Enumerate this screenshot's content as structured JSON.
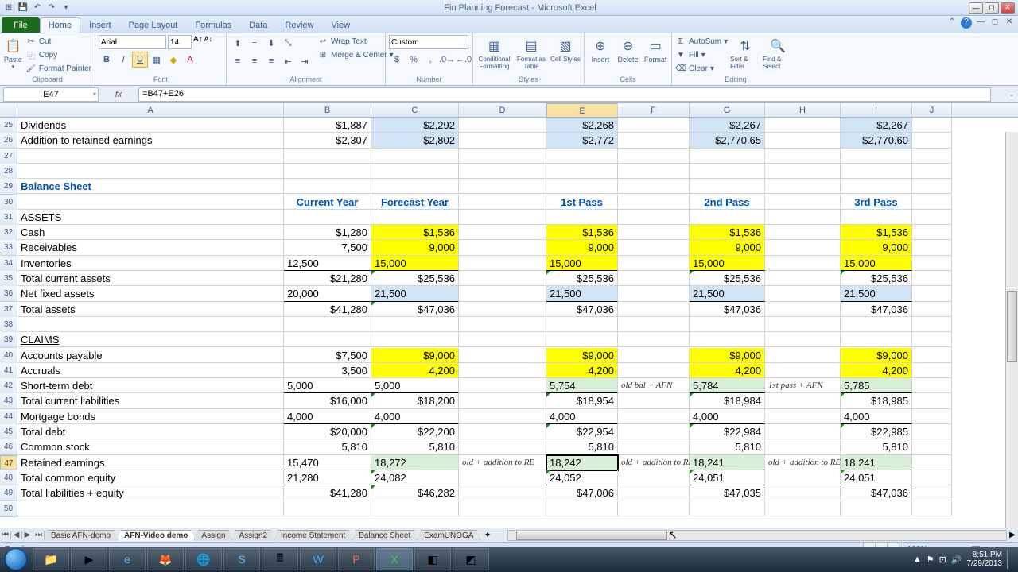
{
  "app": {
    "title": "Fin Planning Forecast - Microsoft Excel"
  },
  "qat": {
    "save": "💾",
    "undo": "↶",
    "redo": "↷"
  },
  "tabs": [
    "File",
    "Home",
    "Insert",
    "Page Layout",
    "Formulas",
    "Data",
    "Review",
    "View"
  ],
  "ribbon": {
    "clipboard": {
      "paste": "Paste",
      "cut": "Cut",
      "copy": "Copy",
      "painter": "Format Painter",
      "label": "Clipboard"
    },
    "font": {
      "name": "Arial",
      "size": "14",
      "label": "Font"
    },
    "alignment": {
      "wrap": "Wrap Text",
      "merge": "Merge & Center",
      "label": "Alignment"
    },
    "number": {
      "format": "Custom",
      "label": "Number"
    },
    "styles": {
      "cond": "Conditional Formatting",
      "table": "Format as Table",
      "cell": "Cell Styles",
      "label": "Styles"
    },
    "cells": {
      "insert": "Insert",
      "delete": "Delete",
      "format": "Format",
      "label": "Cells"
    },
    "editing": {
      "sum": "AutoSum",
      "fill": "Fill",
      "clear": "Clear",
      "sort": "Sort & Filter",
      "find": "Find & Select",
      "label": "Editing"
    }
  },
  "namebox": "E47",
  "formula": "=B47+E26",
  "columns": [
    "A",
    "B",
    "C",
    "D",
    "E",
    "F",
    "G",
    "H",
    "I",
    "J"
  ],
  "rowstart": 25,
  "rows": [
    {
      "n": 25,
      "A": "Dividends",
      "B": "$1,887",
      "C": "$2,292",
      "E": "$2,268",
      "G": "$2,267",
      "I": "$2,267",
      "bg": {
        "C": "lb",
        "E": "lb",
        "G": "lb",
        "I": "lb"
      }
    },
    {
      "n": 26,
      "A": "Addition to retained earnings",
      "B": "$2,307",
      "C": "$2,802",
      "E": "$2,772",
      "G": "$2,770.65",
      "I": "$2,770.60",
      "bg": {
        "C": "lb",
        "E": "lb",
        "G": "lb",
        "I": "lb"
      }
    },
    {
      "n": 27
    },
    {
      "n": 28
    },
    {
      "n": 29,
      "A": "Balance Sheet",
      "cls": {
        "A": "b blue"
      }
    },
    {
      "n": 30,
      "B": "Current Year",
      "C": "Forecast Year",
      "E": "1st Pass",
      "G": "2nd Pass",
      "I": "3rd Pass",
      "cls": {
        "B": "hdr",
        "C": "hdr",
        "E": "hdr",
        "G": "hdr",
        "I": "hdr"
      }
    },
    {
      "n": 31,
      "A": "ASSETS",
      "cls": {
        "A": "u"
      }
    },
    {
      "n": 32,
      "A": "Cash",
      "B": "$1,280",
      "C": "$1,536",
      "E": "$1,536",
      "G": "$1,536",
      "I": "$1,536",
      "bg": {
        "C": "yellow",
        "E": "yellow",
        "G": "yellow",
        "I": "yellow"
      }
    },
    {
      "n": 33,
      "A": "Receivables",
      "B": "7,500",
      "C": "9,000",
      "E": "9,000",
      "G": "9,000",
      "I": "9,000",
      "bg": {
        "C": "yellow",
        "E": "yellow",
        "G": "yellow",
        "I": "yellow"
      }
    },
    {
      "n": 34,
      "A": "Inventories",
      "B": "12,500",
      "C": "15,000",
      "E": "15,000",
      "G": "15,000",
      "I": "15,000",
      "bg": {
        "C": "yellow",
        "E": "yellow",
        "G": "yellow",
        "I": "yellow"
      },
      "cls": {
        "B": "bb",
        "C": "bb",
        "E": "bb",
        "G": "bb",
        "I": "bb"
      }
    },
    {
      "n": 35,
      "A": "     Total current assets",
      "B": "$21,280",
      "C": "$25,536",
      "E": "$25,536",
      "G": "$25,536",
      "I": "$25,536",
      "tri": [
        "C",
        "E",
        "G",
        "I"
      ]
    },
    {
      "n": 36,
      "A": "Net fixed assets",
      "B": "20,000",
      "C": "21,500",
      "E": "21,500",
      "G": "21,500",
      "I": "21,500",
      "bg": {
        "C": "lb",
        "E": "lb",
        "G": "lb",
        "I": "lb"
      },
      "cls": {
        "B": "bb",
        "C": "bb",
        "E": "bb",
        "G": "bb",
        "I": "bb"
      }
    },
    {
      "n": 37,
      "A": "Total assets",
      "B": "$41,280",
      "C": "$47,036",
      "E": "$47,036",
      "G": "$47,036",
      "I": "$47,036",
      "tri": [
        "C"
      ]
    },
    {
      "n": 38
    },
    {
      "n": 39,
      "A": "CLAIMS",
      "cls": {
        "A": "u"
      }
    },
    {
      "n": 40,
      "A": "Accounts payable",
      "B": "$7,500",
      "C": "$9,000",
      "E": "$9,000",
      "G": "$9,000",
      "I": "$9,000",
      "bg": {
        "C": "yellow",
        "E": "yellow",
        "G": "yellow",
        "I": "yellow"
      }
    },
    {
      "n": 41,
      "A": "Accruals",
      "B": "3,500",
      "C": "4,200",
      "E": "4,200",
      "G": "4,200",
      "I": "4,200",
      "bg": {
        "C": "yellow",
        "E": "yellow",
        "G": "yellow",
        "I": "yellow"
      }
    },
    {
      "n": 42,
      "A": "Short-term debt",
      "B": "5,000",
      "C": "5,000",
      "E": "5,754",
      "F": "old bal + AFN",
      "G": "5,784",
      "H": "1st pass + AFN",
      "I": "5,785",
      "bg": {
        "E": "lg",
        "G": "lg",
        "I": "lg"
      },
      "cls": {
        "F": "comic l",
        "H": "comic l",
        "B": "bb",
        "C": "bb",
        "E": "bb",
        "G": "bb",
        "I": "bb"
      }
    },
    {
      "n": 43,
      "A": "     Total current liabilities",
      "B": "$16,000",
      "C": "$18,200",
      "E": "$18,954",
      "G": "$18,984",
      "I": "$18,985",
      "tri": [
        "C",
        "E",
        "G",
        "I"
      ]
    },
    {
      "n": 44,
      "A": "Mortgage bonds",
      "B": "4,000",
      "C": "4,000",
      "E": "4,000",
      "G": "4,000",
      "I": "4,000",
      "cls": {
        "B": "bb",
        "C": "bb",
        "E": "bb",
        "G": "bb",
        "I": "bb"
      }
    },
    {
      "n": 45,
      "A": "     Total debt",
      "B": "$20,000",
      "C": "$22,200",
      "E": "$22,954",
      "G": "$22,984",
      "I": "$22,985",
      "tri": [
        "C",
        "E",
        "G",
        "I"
      ]
    },
    {
      "n": 46,
      "A": "Common stock",
      "B": "5,810",
      "C": "5,810",
      "E": "5,810",
      "G": "5,810",
      "I": "5,810"
    },
    {
      "n": 47,
      "A": "Retained earnings",
      "B": "15,470",
      "C": "18,272",
      "D": "old + addition to RE",
      "E": "18,242",
      "F": "old + addition to RE",
      "G": "18,241",
      "H": "old + addition to RE",
      "I": "18,241",
      "bg": {
        "C": "lg",
        "E": "lg",
        "G": "lg",
        "I": "lg"
      },
      "cls": {
        "D": "comic l",
        "F": "comic l",
        "H": "comic l",
        "B": "bb",
        "C": "bb",
        "E": "bb",
        "G": "bb",
        "I": "bb"
      },
      "active": "E",
      "selrow": true
    },
    {
      "n": 48,
      "A": "     Total common equity",
      "B": "21,280",
      "C": "24,082",
      "E": "24,052",
      "G": "24,051",
      "I": "24,051",
      "tri": [
        "C",
        "E",
        "G",
        "I"
      ],
      "cls": {
        "B": "bb",
        "C": "bb",
        "E": "bb",
        "G": "bb",
        "I": "bb"
      }
    },
    {
      "n": 49,
      "A": "Total liabilities + equity",
      "B": "$41,280",
      "C": "$46,282",
      "E": "$47,006",
      "G": "$47,035",
      "I": "$47,036",
      "tri": [
        "C"
      ]
    },
    {
      "n": 50
    }
  ],
  "sheets": [
    "Basic AFN-demo",
    "AFN-Video demo",
    "Assign",
    "Assign2",
    "Income Statement",
    "Balance Sheet",
    "ExamUNOGA"
  ],
  "activeSheet": 1,
  "status": {
    "ready": "Ready",
    "zoom": "100%"
  },
  "clock": {
    "time": "8:51 PM",
    "date": "7/29/2013"
  }
}
